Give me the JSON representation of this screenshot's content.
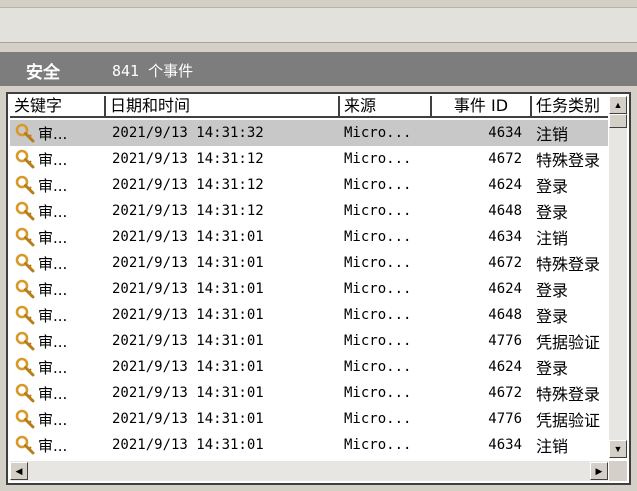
{
  "header": {
    "log_name": "安全",
    "event_count": "841 个事件"
  },
  "columns": [
    "关键字",
    "日期和时间",
    "来源",
    "事件 ID",
    "任务类别"
  ],
  "rows": [
    {
      "key": "审...",
      "date": "2021/9/13 14:31:32",
      "source": "Micro...",
      "id": "4634",
      "category": "注销",
      "selected": true
    },
    {
      "key": "审...",
      "date": "2021/9/13 14:31:12",
      "source": "Micro...",
      "id": "4672",
      "category": "特殊登录"
    },
    {
      "key": "审...",
      "date": "2021/9/13 14:31:12",
      "source": "Micro...",
      "id": "4624",
      "category": "登录"
    },
    {
      "key": "审...",
      "date": "2021/9/13 14:31:12",
      "source": "Micro...",
      "id": "4648",
      "category": "登录"
    },
    {
      "key": "审...",
      "date": "2021/9/13 14:31:01",
      "source": "Micro...",
      "id": "4634",
      "category": "注销"
    },
    {
      "key": "审...",
      "date": "2021/9/13 14:31:01",
      "source": "Micro...",
      "id": "4672",
      "category": "特殊登录"
    },
    {
      "key": "审...",
      "date": "2021/9/13 14:31:01",
      "source": "Micro...",
      "id": "4624",
      "category": "登录"
    },
    {
      "key": "审...",
      "date": "2021/9/13 14:31:01",
      "source": "Micro...",
      "id": "4648",
      "category": "登录"
    },
    {
      "key": "审...",
      "date": "2021/9/13 14:31:01",
      "source": "Micro...",
      "id": "4776",
      "category": "凭据验证"
    },
    {
      "key": "审...",
      "date": "2021/9/13 14:31:01",
      "source": "Micro...",
      "id": "4624",
      "category": "登录"
    },
    {
      "key": "审...",
      "date": "2021/9/13 14:31:01",
      "source": "Micro...",
      "id": "4672",
      "category": "特殊登录"
    },
    {
      "key": "审...",
      "date": "2021/9/13 14:31:01",
      "source": "Micro...",
      "id": "4776",
      "category": "凭据验证"
    },
    {
      "key": "审...",
      "date": "2021/9/13 14:31:01",
      "source": "Micro...",
      "id": "4634",
      "category": "注销"
    }
  ],
  "icons": {
    "keyword": "audit-key-icon",
    "scroll_up": "arrow-up-icon",
    "scroll_down": "arrow-down-icon",
    "scroll_left": "arrow-left-icon",
    "scroll_right": "arrow-right-icon"
  },
  "colors": {
    "header_bg": "#7d7d7d",
    "selected_row": "#c8c8c8",
    "key_icon": "#d79a2a"
  }
}
